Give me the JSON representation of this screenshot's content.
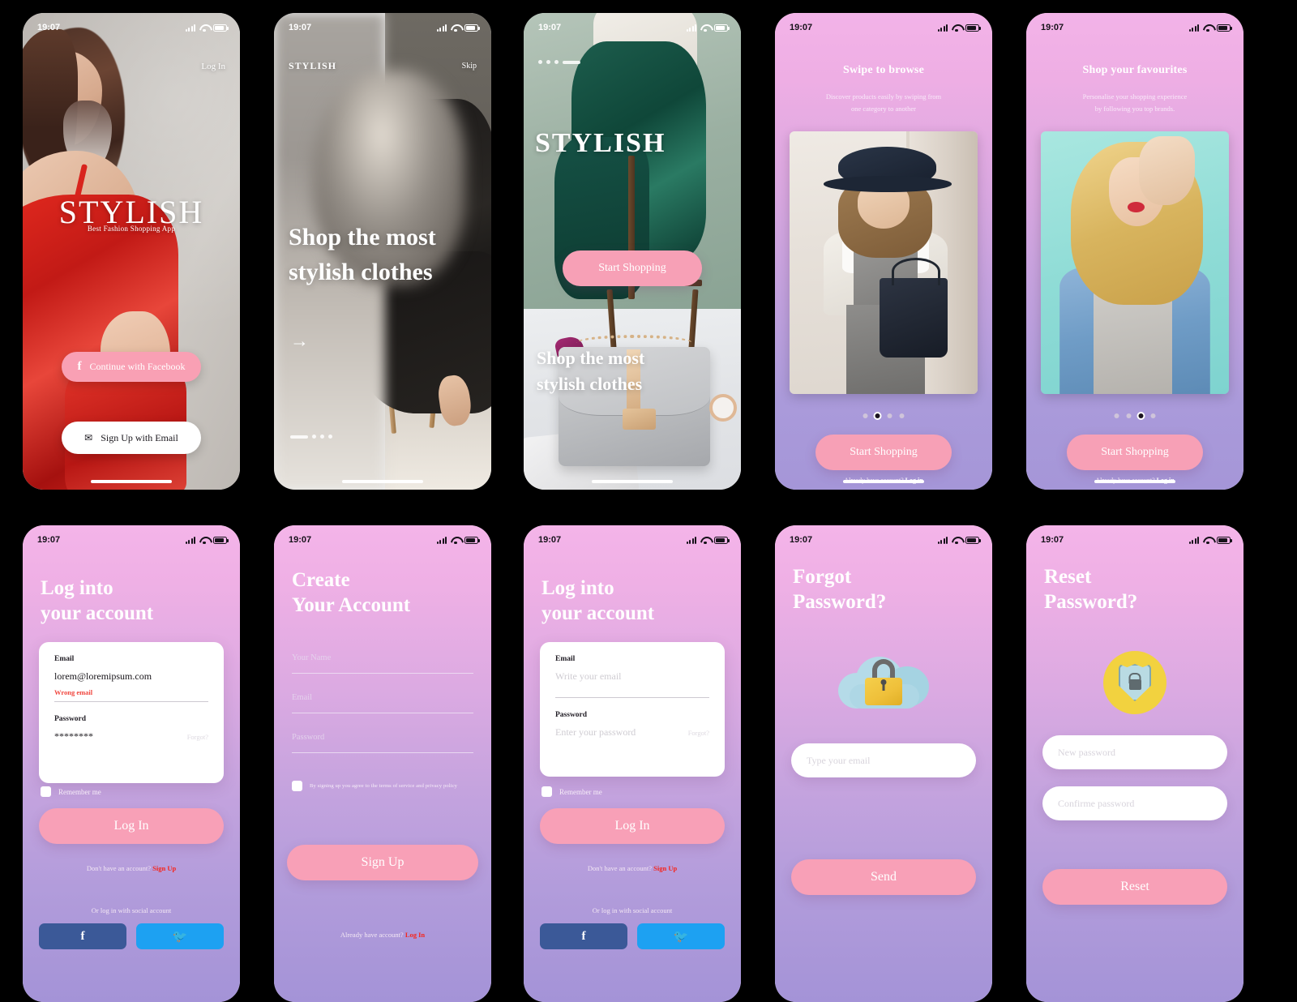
{
  "status_bar": {
    "time": "19:07"
  },
  "screens": [
    {
      "id": "welcome",
      "login_link": "Log In",
      "brand": "STYLISH",
      "tagline": "Best Fashion Shopping App",
      "facebook_button": "Continue with Facebook",
      "email_button": "Sign Up with Email"
    },
    {
      "id": "onboarding-intro",
      "brand": "STYLISH",
      "skip_link": "Skip",
      "headline": "Shop the most stylish clothes",
      "arrow": "→"
    },
    {
      "id": "onboarding-splash",
      "brand": "STYLISH",
      "cta": "Start Shopping",
      "headline": "Shop the most stylish clothes"
    },
    {
      "id": "onboarding-swipe",
      "title": "Swipe to browse",
      "subtitle_line1": "Discover products easily by swiping from",
      "subtitle_line2": "one category to another",
      "cta": "Start Shopping",
      "account_prompt": "Already have account?",
      "account_link": "Log in",
      "dots_total": 4,
      "dots_active": 2
    },
    {
      "id": "onboarding-favourites",
      "title": "Shop your favourites",
      "subtitle_line1": "Personalise your shopping experience",
      "subtitle_line2": "by following you top brands.",
      "cta": "Start Shopping",
      "account_prompt": "Already have account?",
      "account_link": "Log in",
      "dots_total": 4,
      "dots_active": 3
    },
    {
      "id": "login-error",
      "title_line1": "Log into",
      "title_line2": "your account",
      "email_label": "Email",
      "email_value": "lorem@loremipsum.com",
      "email_error": "Wrong email",
      "password_label": "Password",
      "password_value": "********",
      "forgot_link": "Forgot?",
      "remember_label": "Remember me",
      "submit": "Log In",
      "signup_prompt": "Don't have an account?",
      "signup_link": "Sign Up",
      "social_prompt": "Or log in with social account",
      "facebook_icon": "f",
      "twitter_icon": "🐦"
    },
    {
      "id": "signup",
      "title_line1": "Create",
      "title_line2": "Your Account",
      "name_placeholder": "Your Name",
      "email_placeholder": "Email",
      "password_placeholder": "Password",
      "terms_label": "By signing up you agree to the terms of service and privacy policy",
      "submit": "Sign Up",
      "login_prompt": "Already have account?",
      "login_link": "Log In"
    },
    {
      "id": "login-empty",
      "title_line1": "Log into",
      "title_line2": "your account",
      "email_label": "Email",
      "email_placeholder": "Write your email",
      "password_label": "Password",
      "password_placeholder": "Enter your password",
      "forgot_link": "Forgot?",
      "remember_label": "Remember me",
      "submit": "Log In",
      "signup_prompt": "Don't have an account?",
      "signup_link": "Sign Up",
      "social_prompt": "Or log in with social account",
      "facebook_icon": "f",
      "twitter_icon": "🐦"
    },
    {
      "id": "forgot-password",
      "title_line1": "Forgot",
      "title_line2": "Password?",
      "email_placeholder": "Type your email",
      "submit": "Send"
    },
    {
      "id": "reset-password",
      "title_line1": "Reset",
      "title_line2": "Password?",
      "new_password_placeholder": "New password",
      "confirm_password_placeholder": "Confirme password",
      "submit": "Reset"
    }
  ],
  "colors": {
    "pink_accent": "#f8a0b7",
    "error_red": "#f5261d",
    "facebook_blue": "#3b5998",
    "twitter_blue": "#1da1f2",
    "gradient_top": "#f4b4e9",
    "gradient_bottom": "#a493d7",
    "badge_yellow": "#f2d23f"
  }
}
